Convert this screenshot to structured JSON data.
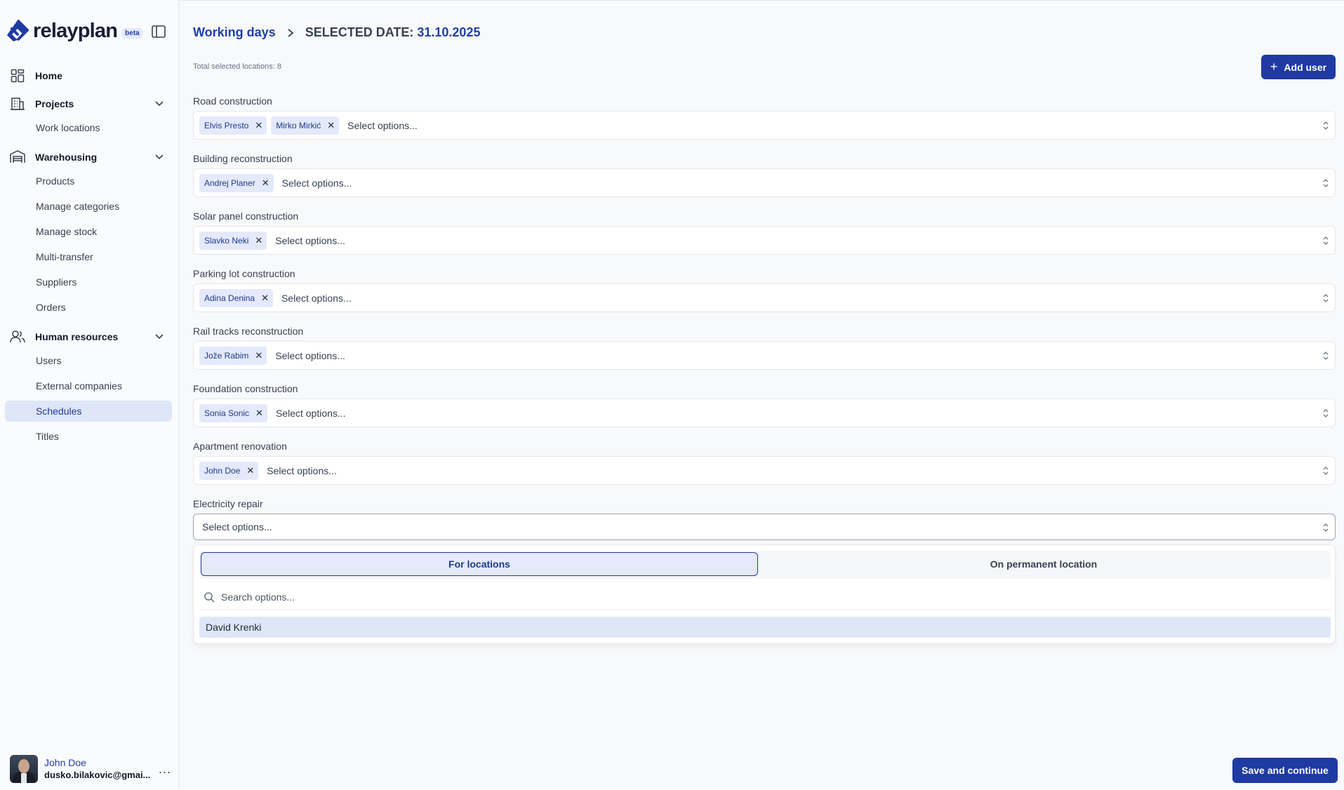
{
  "app": {
    "logo_text": "relayplan",
    "badge": "beta"
  },
  "sidebar": {
    "items": [
      {
        "label": "Home",
        "icon": "grid-icon"
      },
      {
        "label": "Projects",
        "icon": "building-icon",
        "expanded": true,
        "children": [
          {
            "label": "Work locations"
          }
        ]
      },
      {
        "label": "Warehousing",
        "icon": "warehouse-icon",
        "expanded": true,
        "children": [
          {
            "label": "Products"
          },
          {
            "label": "Manage categories"
          },
          {
            "label": "Manage stock"
          },
          {
            "label": "Multi-transfer"
          },
          {
            "label": "Suppliers"
          },
          {
            "label": "Orders"
          }
        ]
      },
      {
        "label": "Human resources",
        "icon": "users-icon",
        "expanded": true,
        "children": [
          {
            "label": "Users"
          },
          {
            "label": "External companies"
          },
          {
            "label": "Schedules",
            "active": true
          },
          {
            "label": "Titles"
          }
        ]
      }
    ]
  },
  "user": {
    "name": "John Doe",
    "email": "dusko.bilakovic@gmai...",
    "more": "..."
  },
  "header": {
    "breadcrumb_link": "Working days",
    "selected_label": "SELECTED DATE:",
    "selected_date": "31.10.2025",
    "total_selected": "Total selected locations: 8",
    "add_user_label": "Add user"
  },
  "locations": [
    {
      "name": "Road construction",
      "assigned": [
        "Elvis Presto",
        "Mirko Mirkić"
      ]
    },
    {
      "name": "Building reconstruction",
      "assigned": [
        "Andrej Planer"
      ]
    },
    {
      "name": "Solar panel construction",
      "assigned": [
        "Slavko Neki"
      ]
    },
    {
      "name": "Parking lot construction",
      "assigned": [
        "Adina Denina"
      ]
    },
    {
      "name": "Rail tracks reconstruction",
      "assigned": [
        "Jože Rabim"
      ]
    },
    {
      "name": "Foundation construction",
      "assigned": [
        "Sonia Sonic"
      ]
    },
    {
      "name": "Apartment renovation",
      "assigned": [
        "John Doe"
      ]
    },
    {
      "name": "Electricity repair",
      "assigned": []
    }
  ],
  "select_placeholder": "Select options...",
  "dropdown": {
    "tabs": [
      "For locations",
      "On permanent location"
    ],
    "active_tab": "For locations",
    "search_placeholder": "Search options...",
    "options": [
      "David Krenki"
    ]
  },
  "footer": {
    "save_label": "Save and continue"
  },
  "colors": {
    "accent": "#1f3aa3",
    "chip_bg": "#e4e9fb",
    "active_nav_bg": "#dfe6f7"
  }
}
